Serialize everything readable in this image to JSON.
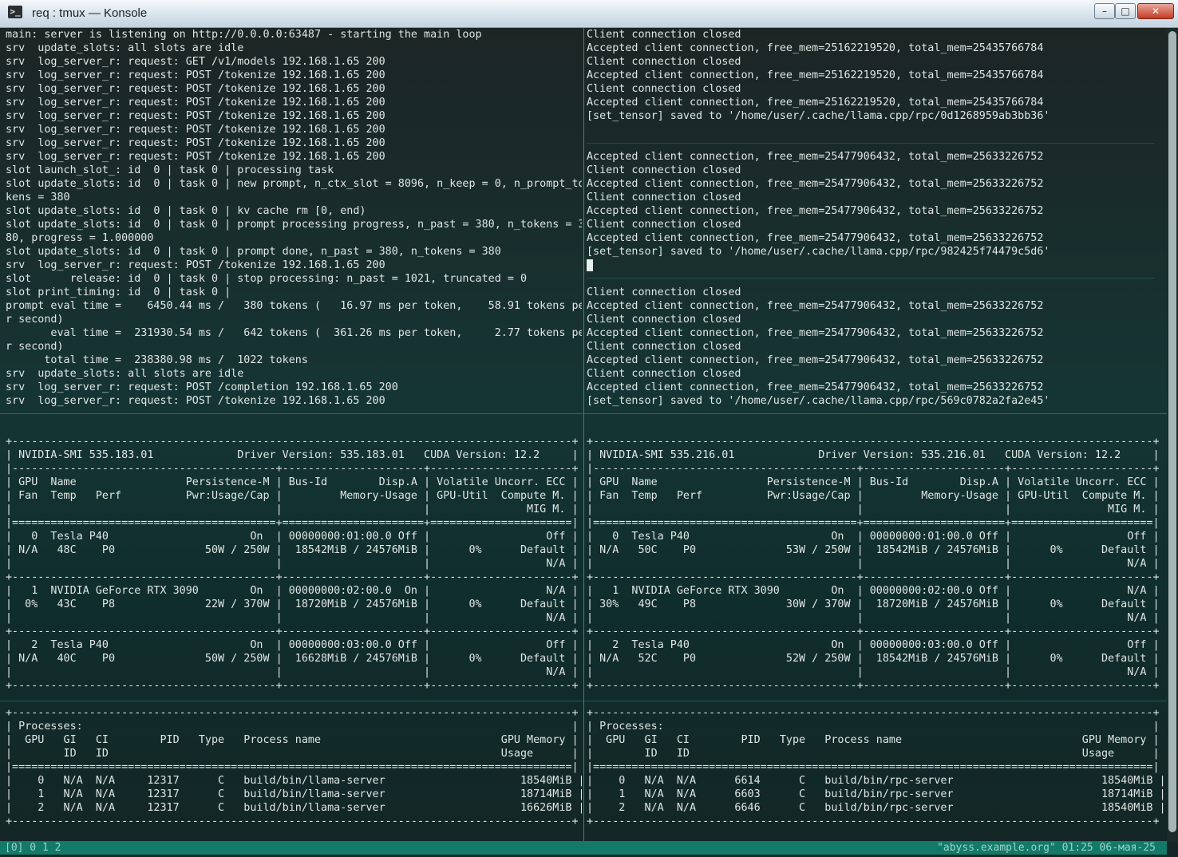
{
  "window": {
    "title": "req : tmux — Konsole",
    "icon": "terminal-icon",
    "buttons": {
      "minimize": "–",
      "maximize": "□",
      "close": "✕"
    }
  },
  "panes": {
    "server_log": [
      "main: server is listening on http://0.0.0.0:63487 - starting the main loop",
      "srv  update_slots: all slots are idle",
      "srv  log_server_r: request: GET /v1/models 192.168.1.65 200",
      "srv  log_server_r: request: POST /tokenize 192.168.1.65 200",
      "srv  log_server_r: request: POST /tokenize 192.168.1.65 200",
      "srv  log_server_r: request: POST /tokenize 192.168.1.65 200",
      "srv  log_server_r: request: POST /tokenize 192.168.1.65 200",
      "srv  log_server_r: request: POST /tokenize 192.168.1.65 200",
      "srv  log_server_r: request: POST /tokenize 192.168.1.65 200",
      "srv  log_server_r: request: POST /tokenize 192.168.1.65 200",
      "slot launch_slot_: id  0 | task 0 | processing task",
      "slot update_slots: id  0 | task 0 | new prompt, n_ctx_slot = 8096, n_keep = 0, n_prompt_to",
      "kens = 380",
      "slot update_slots: id  0 | task 0 | kv cache rm [0, end)",
      "slot update_slots: id  0 | task 0 | prompt processing progress, n_past = 380, n_tokens = 3",
      "80, progress = 1.000000",
      "slot update_slots: id  0 | task 0 | prompt done, n_past = 380, n_tokens = 380",
      "srv  log_server_r: request: POST /tokenize 192.168.1.65 200",
      "slot      release: id  0 | task 0 | stop processing: n_past = 1021, truncated = 0",
      "slot print_timing: id  0 | task 0 |",
      "prompt eval time =    6450.44 ms /   380 tokens (   16.97 ms per token,    58.91 tokens pe",
      "r second)",
      "       eval time =  231930.54 ms /   642 tokens (  361.26 ms per token,     2.77 tokens pe",
      "r second)",
      "      total time =  238380.98 ms /  1022 tokens",
      "srv  update_slots: all slots are idle",
      "srv  log_server_r: request: POST /completion 192.168.1.65 200",
      "srv  log_server_r: request: POST /tokenize 192.168.1.65 200"
    ],
    "rpc_log": [
      "Client connection closed",
      "Accepted client connection, free_mem=25162219520, total_mem=25435766784",
      "Client connection closed",
      "Accepted client connection, free_mem=25162219520, total_mem=25435766784",
      "Client connection closed",
      "Accepted client connection, free_mem=25162219520, total_mem=25435766784",
      "[set_tensor] saved to '/home/user/.cache/llama.cpp/rpc/0d1268959ab3bb36'",
      "",
      "",
      "Accepted client connection, free_mem=25477906432, total_mem=25633226752",
      "Client connection closed",
      "Accepted client connection, free_mem=25477906432, total_mem=25633226752",
      "Client connection closed",
      "Accepted client connection, free_mem=25477906432, total_mem=25633226752",
      "Client connection closed",
      "Accepted client connection, free_mem=25477906432, total_mem=25633226752",
      "[set_tensor] saved to '/home/user/.cache/llama.cpp/rpc/982425f74479c5d6'",
      "",
      "",
      "Client connection closed",
      "Accepted client connection, free_mem=25477906432, total_mem=25633226752",
      "Client connection closed",
      "Accepted client connection, free_mem=25477906432, total_mem=25633226752",
      "Client connection closed",
      "Accepted client connection, free_mem=25477906432, total_mem=25633226752",
      "Client connection closed",
      "Accepted client connection, free_mem=25477906432, total_mem=25633226752",
      "[set_tensor] saved to '/home/user/.cache/llama.cpp/rpc/569c0782a2fa2e45'"
    ],
    "smi_left": [
      "+---------------------------------------------------------------------------------------+",
      "| NVIDIA-SMI 535.183.01             Driver Version: 535.183.01   CUDA Version: 12.2     |",
      "|-----------------------------------------+----------------------+----------------------+",
      "| GPU  Name                 Persistence-M | Bus-Id        Disp.A | Volatile Uncorr. ECC |",
      "| Fan  Temp   Perf          Pwr:Usage/Cap |         Memory-Usage | GPU-Util  Compute M. |",
      "|                                         |                      |               MIG M. |",
      "|=========================================+======================+======================|",
      "|   0  Tesla P40                      On  | 00000000:01:00.0 Off |                  Off |",
      "| N/A   48C    P0              50W / 250W |  18542MiB / 24576MiB |      0%      Default |",
      "|                                         |                      |                  N/A |",
      "+-----------------------------------------+----------------------+----------------------+",
      "|   1  NVIDIA GeForce RTX 3090        On  | 00000000:02:00.0  On |                  N/A |",
      "|  0%   43C    P8              22W / 370W |  18720MiB / 24576MiB |      0%      Default |",
      "|                                         |                      |                  N/A |",
      "+-----------------------------------------+----------------------+----------------------+",
      "|   2  Tesla P40                      On  | 00000000:03:00.0 Off |                  Off |",
      "| N/A   40C    P0              50W / 250W |  16628MiB / 24576MiB |      0%      Default |",
      "|                                         |                      |                  N/A |",
      "+-----------------------------------------+----------------------+----------------------+",
      "",
      "+---------------------------------------------------------------------------------------+",
      "| Processes:                                                                            |",
      "|  GPU   GI   CI        PID   Type   Process name                            GPU Memory |",
      "|        ID   ID                                                             Usage      |",
      "|=======================================================================================|",
      "|    0   N/A  N/A     12317      C   build/bin/llama-server                     18540MiB |",
      "|    1   N/A  N/A     12317      C   build/bin/llama-server                     18714MiB |",
      "|    2   N/A  N/A     12317      C   build/bin/llama-server                     16626MiB |",
      "+---------------------------------------------------------------------------------------+"
    ],
    "smi_right": [
      "+---------------------------------------------------------------------------------------+",
      "| NVIDIA-SMI 535.216.01             Driver Version: 535.216.01   CUDA Version: 12.2     |",
      "|-----------------------------------------+----------------------+----------------------+",
      "| GPU  Name                 Persistence-M | Bus-Id        Disp.A | Volatile Uncorr. ECC |",
      "| Fan  Temp   Perf          Pwr:Usage/Cap |         Memory-Usage | GPU-Util  Compute M. |",
      "|                                         |                      |               MIG M. |",
      "|=========================================+======================+======================|",
      "|   0  Tesla P40                      On  | 00000000:01:00.0 Off |                  Off |",
      "| N/A   50C    P0              53W / 250W |  18542MiB / 24576MiB |      0%      Default |",
      "|                                         |                      |                  N/A |",
      "+-----------------------------------------+----------------------+----------------------+",
      "|   1  NVIDIA GeForce RTX 3090        On  | 00000000:02:00.0 Off |                  N/A |",
      "| 30%   49C    P8              30W / 370W |  18720MiB / 24576MiB |      0%      Default |",
      "|                                         |                      |                  N/A |",
      "+-----------------------------------------+----------------------+----------------------+",
      "|   2  Tesla P40                      On  | 00000000:03:00.0 Off |                  Off |",
      "| N/A   52C    P0              52W / 250W |  18542MiB / 24576MiB |      0%      Default |",
      "|                                         |                      |                  N/A |",
      "+-----------------------------------------+----------------------+----------------------+",
      "",
      "+---------------------------------------------------------------------------------------+",
      "| Processes:                                                                            |",
      "|  GPU   GI   CI        PID   Type   Process name                            GPU Memory |",
      "|        ID   ID                                                             Usage      |",
      "|=======================================================================================|",
      "|    0   N/A  N/A      6614      C   build/bin/rpc-server                       18540MiB |",
      "|    1   N/A  N/A      6603      C   build/bin/rpc-server                       18714MiB |",
      "|    2   N/A  N/A      6646      C   build/bin/rpc-server                       18540MiB |",
      "+---------------------------------------------------------------------------------------+"
    ]
  },
  "status_bar": {
    "left": "[0] 0 1 2",
    "right": "\"abyss.example.org\" 01:25 06-мая-25"
  },
  "colors": {
    "status_bar_bg": "#137a6a",
    "terminal_text": "#dfe6e4",
    "pane_separator": "#4f7a76"
  }
}
